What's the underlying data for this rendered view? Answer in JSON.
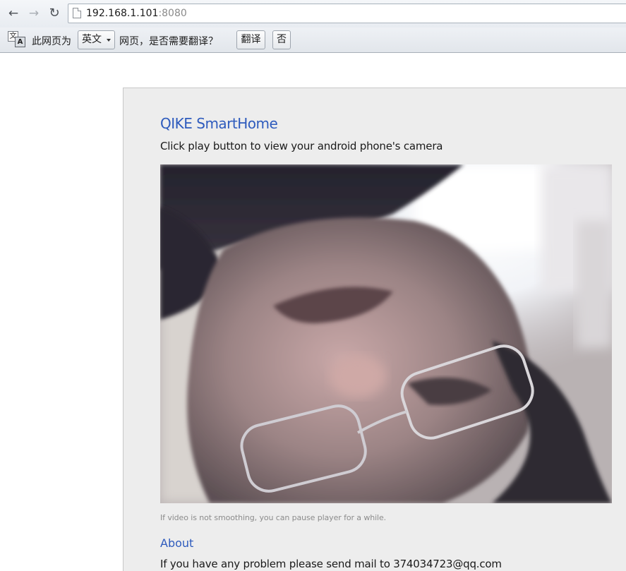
{
  "browser": {
    "url_host": "192.168.1.101",
    "url_port": ":8080",
    "back_icon": "←",
    "forward_icon": "→",
    "reload_icon": "↻"
  },
  "translate_bar": {
    "prefix": "此网页为",
    "language": "英文",
    "suffix": "网页，是否需要翻译？",
    "translate_label": "翻译",
    "no_label": "否",
    "icon_src": "文",
    "icon_dst": "A"
  },
  "page": {
    "title": "QIKE SmartHome",
    "subtitle": "Click play button to view your android phone's camera",
    "video_note": "If video is not smoothing, you can pause player for a while.",
    "about_heading": "About",
    "about_text": "If you have any problem please send mail to 374034723@qq.com"
  }
}
